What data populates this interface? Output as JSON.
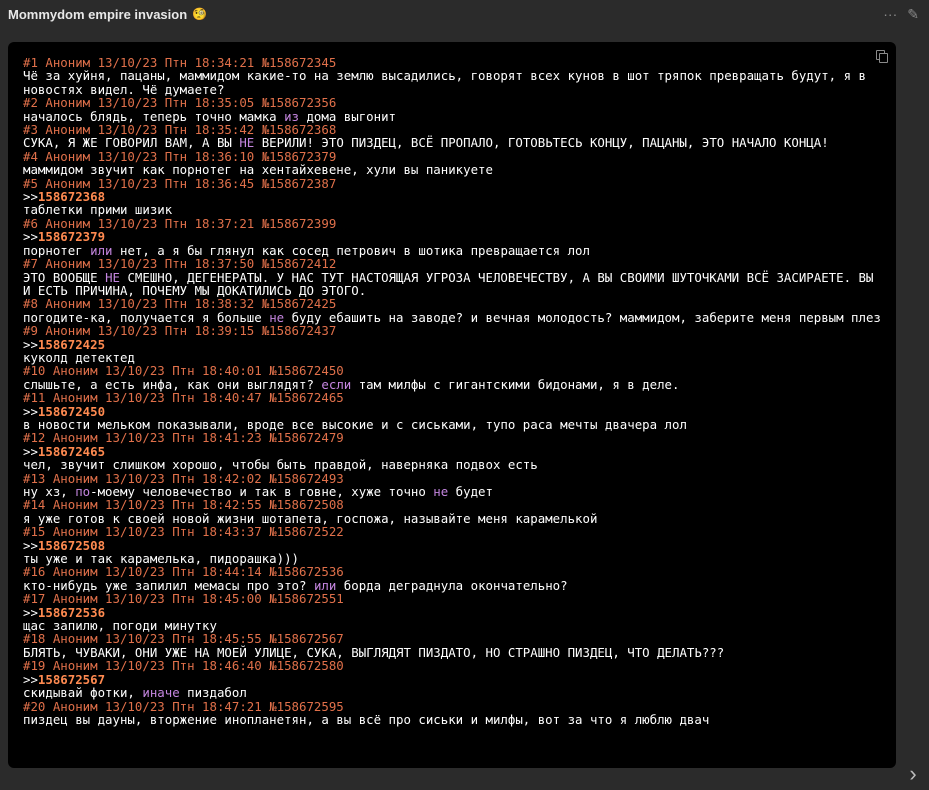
{
  "header": {
    "title": "Mommydom empire invasion",
    "title_emoji": "🧐",
    "more_label": "···",
    "edit_label": "✎"
  },
  "code_lines": [
    {
      "t": "h",
      "text": "#1 Аноним 13/10/23 Птн 18:34:21 №158672345"
    },
    {
      "t": "p",
      "text": "Чё за хуйня, пацаны, маммидом какие-то на землю высадились, говорят всех кунов в шот тряпок превращать будут, я в новостях видел. Чё думаете?"
    },
    {
      "t": "h",
      "text": "#2 Аноним 13/10/23 Птн 18:35:05 №158672356"
    },
    {
      "t": "p",
      "parts": [
        {
          "s": "началось блядь, теперь точно мамка "
        },
        {
          "s": "из",
          "k": 1
        },
        {
          "s": " дома выгонит"
        }
      ]
    },
    {
      "t": "h",
      "text": "#3 Аноним 13/10/23 Птн 18:35:42 №158672368"
    },
    {
      "t": "p",
      "parts": [
        {
          "s": "СУКА, Я ЖЕ ГОВОРИЛ ВАМ, А ВЫ "
        },
        {
          "s": "НЕ",
          "k": 1
        },
        {
          "s": " ВЕРИЛИ! ЭТО ПИЗДЕЦ, ВСЁ ПРОПАЛО, ГОТОВЬТЕСЬ КОНЦУ, ПАЦАНЫ, ЭТО НАЧАЛО КОНЦА!"
        }
      ]
    },
    {
      "t": "h",
      "text": "#4 Аноним 13/10/23 Птн 18:36:10 №158672379"
    },
    {
      "t": "p",
      "text": "маммидом звучит как порнотег на хентайхевене, хули вы паникуете"
    },
    {
      "t": "h",
      "text": "#5 Аноним 13/10/23 Птн 18:36:45 №158672387"
    },
    {
      "t": "r",
      "text": "158672368"
    },
    {
      "t": "p",
      "text": "таблетки прими шизик"
    },
    {
      "t": "h",
      "text": "#6 Аноним 13/10/23 Птн 18:37:21 №158672399"
    },
    {
      "t": "r",
      "text": "158672379"
    },
    {
      "t": "p",
      "parts": [
        {
          "s": "порнотег "
        },
        {
          "s": "или",
          "k": 1
        },
        {
          "s": " нет, а я бы глянул как сосед петрович в шотика превращается лол"
        }
      ]
    },
    {
      "t": "h",
      "text": "#7 Аноним 13/10/23 Птн 18:37:50 №158672412"
    },
    {
      "t": "p",
      "parts": [
        {
          "s": "ЭТО ВООБЩЕ "
        },
        {
          "s": "НЕ",
          "k": 1
        },
        {
          "s": " СМЕШНО, ДЕГЕНЕРАТЫ. У НАС ТУТ НАСТОЯЩАЯ УГРОЗА ЧЕЛОВЕЧЕСТВУ, А ВЫ СВОИМИ ШУТОЧКАМИ ВСЁ ЗАСИРАЕТЕ. ВЫ И ЕСТЬ ПРИЧИНА, ПОЧЕМУ МЫ ДОКАТИЛИСЬ ДО ЭТОГО."
        }
      ]
    },
    {
      "t": "h",
      "text": "#8 Аноним 13/10/23 Птн 18:38:32 №158672425"
    },
    {
      "t": "p",
      "parts": [
        {
          "s": "погодите-ка, получается я больше "
        },
        {
          "s": "не",
          "k": 1
        },
        {
          "s": " буду ебашить на заводе? и вечная молодость? маммидом, заберите меня первым плез"
        }
      ]
    },
    {
      "t": "h",
      "text": "#9 Аноним 13/10/23 Птн 18:39:15 №158672437"
    },
    {
      "t": "r",
      "text": "158672425"
    },
    {
      "t": "p",
      "text": "куколд детектед"
    },
    {
      "t": "h",
      "text": "#10 Аноним 13/10/23 Птн 18:40:01 №158672450"
    },
    {
      "t": "p",
      "parts": [
        {
          "s": "слышьте, а есть инфа, как они выглядят? "
        },
        {
          "s": "если",
          "k": 1
        },
        {
          "s": " там милфы с гигантскими бидонами, я в деле."
        }
      ]
    },
    {
      "t": "h",
      "text": "#11 Аноним 13/10/23 Птн 18:40:47 №158672465"
    },
    {
      "t": "r",
      "text": "158672450"
    },
    {
      "t": "p",
      "text": "в новости мельком показывали, вроде все высокие и с сиськами, тупо раса мечты двачера лол"
    },
    {
      "t": "h",
      "text": "#12 Аноним 13/10/23 Птн 18:41:23 №158672479"
    },
    {
      "t": "r",
      "text": "158672465"
    },
    {
      "t": "p",
      "text": "чел, звучит слишком хорошо, чтобы быть правдой, наверняка подвох есть"
    },
    {
      "t": "h",
      "text": "#13 Аноним 13/10/23 Птн 18:42:02 №158672493"
    },
    {
      "t": "p",
      "parts": [
        {
          "s": "ну хз, "
        },
        {
          "s": "по",
          "k": 1
        },
        {
          "s": "-моему человечество и так в говне, хуже точно "
        },
        {
          "s": "не",
          "k": 1
        },
        {
          "s": " будет"
        }
      ]
    },
    {
      "t": "h",
      "text": "#14 Аноним 13/10/23 Птн 18:42:55 №158672508"
    },
    {
      "t": "p",
      "text": "я уже готов к своей новой жизни шотапета, госпожа, называйте меня карамелькой"
    },
    {
      "t": "h",
      "text": "#15 Аноним 13/10/23 Птн 18:43:37 №158672522"
    },
    {
      "t": "r",
      "text": "158672508"
    },
    {
      "t": "p",
      "text": "ты уже и так карамелька, пидорашка)))"
    },
    {
      "t": "h",
      "text": "#16 Аноним 13/10/23 Птн 18:44:14 №158672536"
    },
    {
      "t": "p",
      "parts": [
        {
          "s": "кто-нибудь уже запилил мемасы про это? "
        },
        {
          "s": "или",
          "k": 1
        },
        {
          "s": " борда деградну­ла окончательно?"
        }
      ]
    },
    {
      "t": "h",
      "text": "#17 Аноним 13/10/23 Птн 18:45:00 №158672551"
    },
    {
      "t": "r",
      "text": "158672536"
    },
    {
      "t": "p",
      "text": "щас запилю, погоди минутку"
    },
    {
      "t": "h",
      "text": "#18 Аноним 13/10/23 Птн 18:45:55 №158672567"
    },
    {
      "t": "p",
      "text": "БЛЯТЬ, ЧУВАКИ, ОНИ УЖЕ НА МОЕЙ УЛИЦЕ, СУКА, ВЫГЛЯДЯТ ПИЗДАТО, НО СТРАШНО ПИЗДЕЦ, ЧТО ДЕЛАТЬ???"
    },
    {
      "t": "h",
      "text": "#19 Аноним 13/10/23 Птн 18:46:40 №158672580"
    },
    {
      "t": "r",
      "text": "158672567"
    },
    {
      "t": "p",
      "parts": [
        {
          "s": "скидывай фотки, "
        },
        {
          "s": "иначе",
          "k": 1
        },
        {
          "s": " пиздабол"
        }
      ]
    },
    {
      "t": "h",
      "text": "#20 Аноним 13/10/23 Птн 18:47:21 №158672595"
    },
    {
      "t": "p",
      "text": "пиздец вы дауны, вторжение инопланетян, а вы всё про сиськи и милфы, вот за что я люблю двач"
    }
  ],
  "next_label": "›",
  "colors": {
    "header_text": "#e0704a",
    "keyword": "#c586e0",
    "reply_link": "#ff8a50",
    "code_bg": "#000000",
    "page_bg": "#2b2b2b"
  }
}
